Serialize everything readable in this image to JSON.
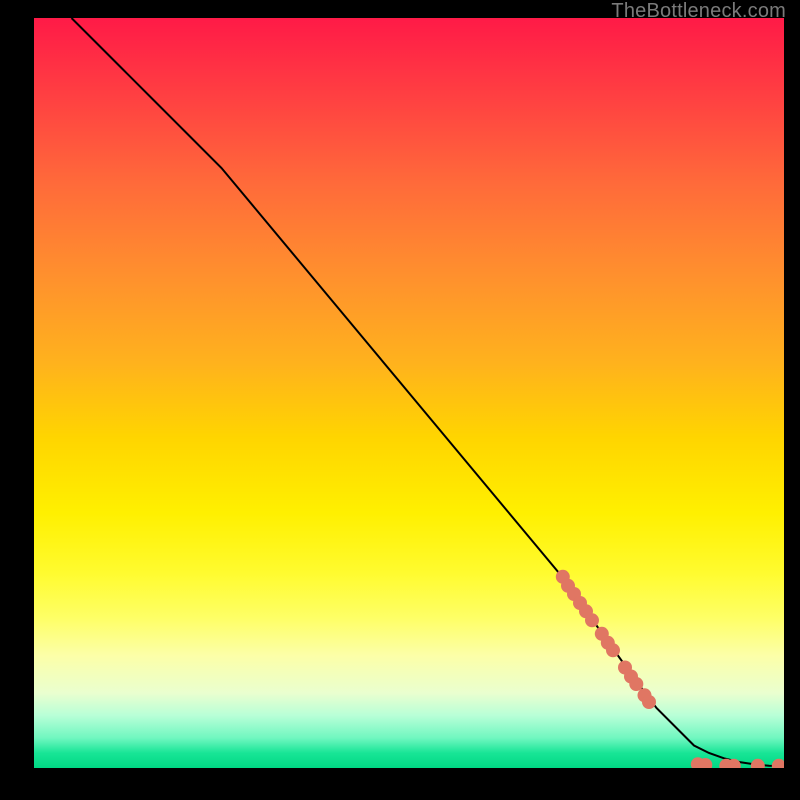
{
  "attribution": "TheBottleneck.com",
  "colors": {
    "point_fill": "#e07663",
    "curve_stroke": "#000000"
  },
  "chart_data": {
    "type": "line",
    "title": "",
    "xlabel": "",
    "ylabel": "",
    "xlim": [
      0,
      100
    ],
    "ylim": [
      0,
      100
    ],
    "grid": false,
    "series": [
      {
        "name": "curve",
        "x": [
          5,
          8,
          12,
          16,
          20,
          25,
          30,
          35,
          40,
          45,
          50,
          55,
          60,
          65,
          70,
          75,
          80,
          83,
          86,
          88,
          90,
          92,
          94,
          96,
          98,
          100
        ],
        "y": [
          100,
          97,
          93,
          89,
          85,
          80,
          74,
          68,
          62,
          56,
          50,
          44,
          38,
          32,
          26,
          19,
          12,
          8,
          5,
          3,
          2,
          1.3,
          0.8,
          0.5,
          0.3,
          0.25
        ]
      }
    ],
    "points": [
      {
        "x": 70.5,
        "y": 25.5
      },
      {
        "x": 71.2,
        "y": 24.3
      },
      {
        "x": 72.0,
        "y": 23.2
      },
      {
        "x": 72.8,
        "y": 22.0
      },
      {
        "x": 73.6,
        "y": 20.9
      },
      {
        "x": 74.4,
        "y": 19.7
      },
      {
        "x": 75.7,
        "y": 17.9
      },
      {
        "x": 76.5,
        "y": 16.7
      },
      {
        "x": 77.2,
        "y": 15.7
      },
      {
        "x": 78.8,
        "y": 13.4
      },
      {
        "x": 79.6,
        "y": 12.2
      },
      {
        "x": 80.3,
        "y": 11.2
      },
      {
        "x": 81.4,
        "y": 9.7
      },
      {
        "x": 82.0,
        "y": 8.8
      },
      {
        "x": 88.5,
        "y": 0.5
      },
      {
        "x": 89.5,
        "y": 0.4
      },
      {
        "x": 92.3,
        "y": 0.3
      },
      {
        "x": 93.3,
        "y": 0.3
      },
      {
        "x": 96.5,
        "y": 0.3
      },
      {
        "x": 99.3,
        "y": 0.3
      }
    ]
  }
}
